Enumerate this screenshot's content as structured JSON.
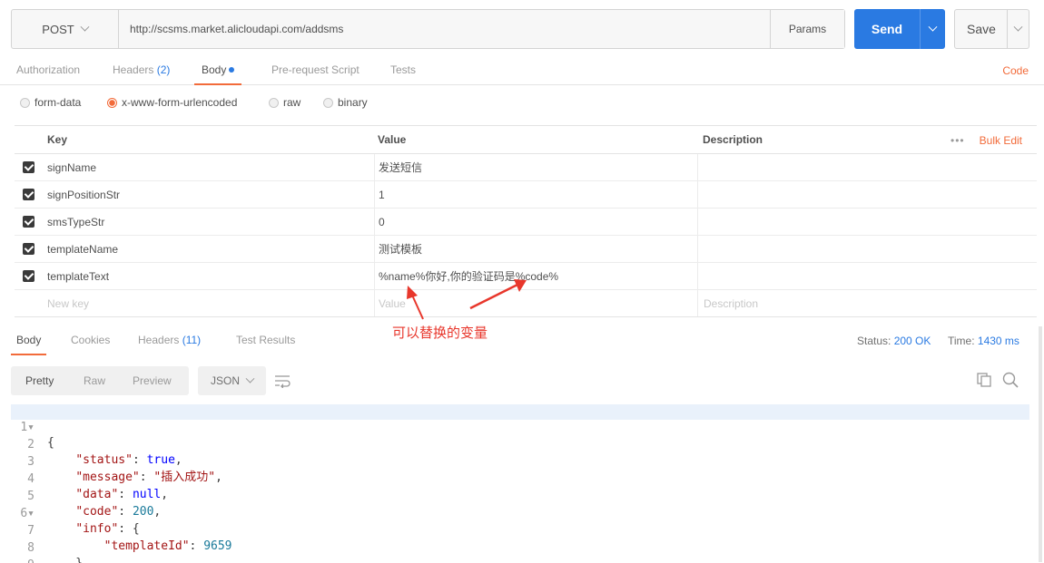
{
  "request": {
    "method": "POST",
    "url": "http://scsms.market.alicloudapi.com/addsms",
    "params_label": "Params",
    "send_label": "Send",
    "save_label": "Save"
  },
  "request_tabs": [
    {
      "label": "Authorization",
      "count": ""
    },
    {
      "label": "Headers",
      "count": "(2)"
    },
    {
      "label": "Body",
      "count": ""
    },
    {
      "label": "Pre-request Script",
      "count": ""
    },
    {
      "label": "Tests",
      "count": ""
    }
  ],
  "code_link": "Code",
  "body_types": [
    "form-data",
    "x-www-form-urlencoded",
    "raw",
    "binary"
  ],
  "table": {
    "headers": {
      "key": "Key",
      "value": "Value",
      "description": "Description"
    },
    "more": "•••",
    "bulk_edit": "Bulk Edit",
    "rows": [
      {
        "key": "signName",
        "value": "发送短信",
        "description": ""
      },
      {
        "key": "signPositionStr",
        "value": "1",
        "description": ""
      },
      {
        "key": "smsTypeStr",
        "value": "0",
        "description": ""
      },
      {
        "key": "templateName",
        "value": "测试模板",
        "description": ""
      },
      {
        "key": "templateText",
        "value": "%name%你好,你的验证码是%code%",
        "description": ""
      }
    ],
    "new_row": {
      "key": "New key",
      "value": "Value",
      "description": "Description"
    }
  },
  "annotation": "可以替换的变量",
  "response_tabs": [
    {
      "label": "Body",
      "count": ""
    },
    {
      "label": "Cookies",
      "count": ""
    },
    {
      "label": "Headers",
      "count": "(11)"
    },
    {
      "label": "Test Results",
      "count": ""
    }
  ],
  "response_status": {
    "status_label": "Status:",
    "status_value": "200 OK",
    "time_label": "Time:",
    "time_value": "1430 ms"
  },
  "view_modes": [
    "Pretty",
    "Raw",
    "Preview"
  ],
  "format": "JSON",
  "code_lines": [
    {
      "n": "1",
      "text": "{"
    },
    {
      "n": "2",
      "text": "    \"status\": true,"
    },
    {
      "n": "3",
      "text": "    \"message\": \"插入成功\","
    },
    {
      "n": "4",
      "text": "    \"data\": null,"
    },
    {
      "n": "5",
      "text": "    \"code\": 200,"
    },
    {
      "n": "6",
      "text": "    \"info\": {"
    },
    {
      "n": "7",
      "text": "        \"templateId\": 9659"
    },
    {
      "n": "8",
      "text": "    }"
    },
    {
      "n": "9",
      "text": "}"
    }
  ],
  "colors": {
    "accent": "#2a7ae2",
    "tab_indicator": "#f26b3a",
    "annotation": "#e8372c"
  },
  "icons": [
    "chevron-down-icon",
    "checkbox-checked-icon",
    "wrap-lines-icon",
    "copy-icon",
    "search-icon",
    "fold-arrow-icon"
  ]
}
